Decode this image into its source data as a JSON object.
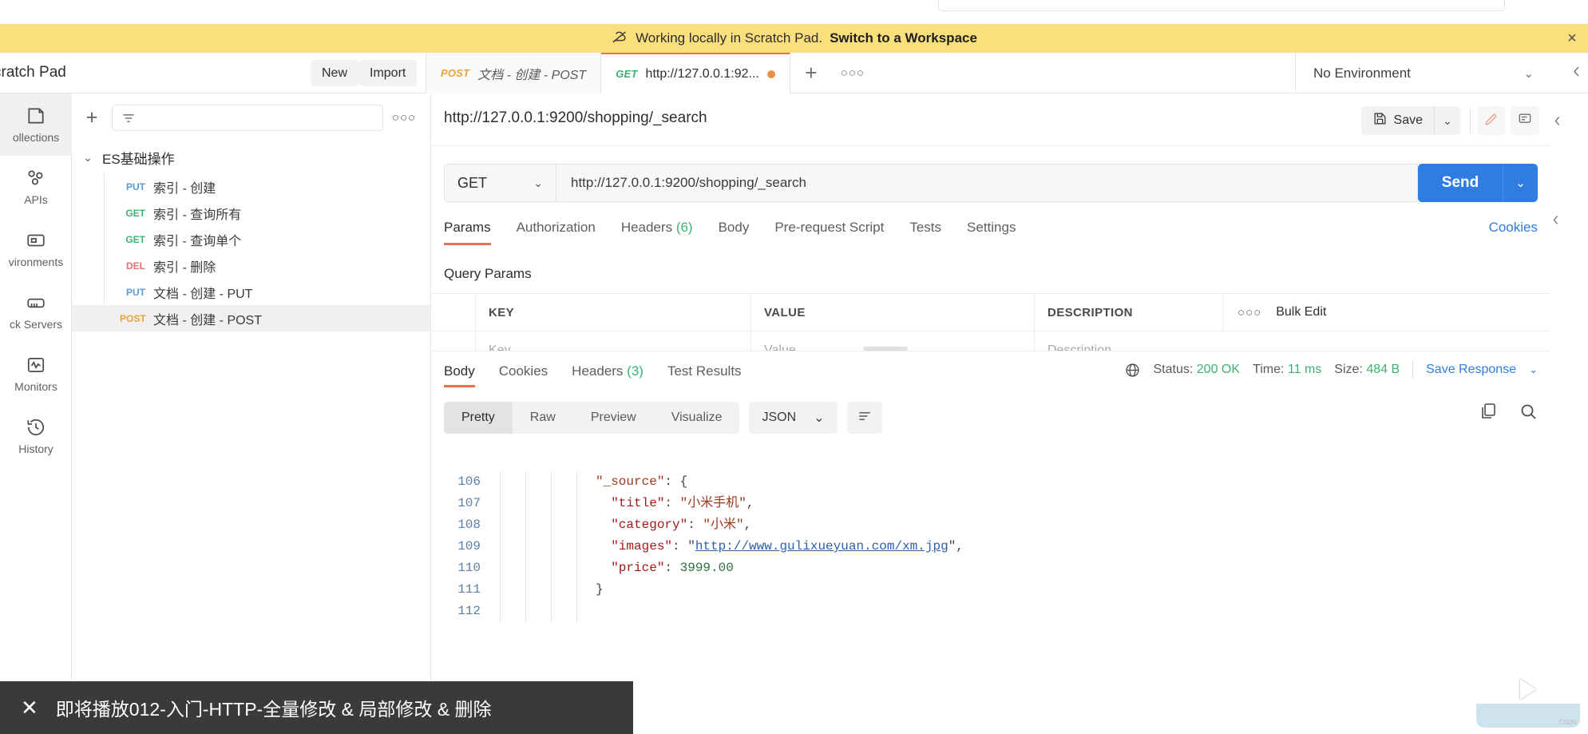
{
  "banner": {
    "icon": "cloud-off-icon",
    "text": "Working locally in Scratch Pad.",
    "link": "Switch to a Workspace",
    "close": "×"
  },
  "header": {
    "workspace_title": "cratch Pad",
    "new_label": "New",
    "import_label": "Import",
    "environment": {
      "selected": "No Environment",
      "caret": "⌄"
    },
    "tabs": [
      {
        "method": "POST",
        "label": "文档 - 创建 - POST",
        "active": false,
        "unsaved": false
      },
      {
        "method": "GET",
        "label": "http://127.0.0.1:92...",
        "active": true,
        "unsaved": true
      }
    ],
    "new_tab_label": "+",
    "tab_options_label": "○○○"
  },
  "rail": {
    "items": [
      {
        "label": "ollections",
        "icon": "collections-icon",
        "active": true
      },
      {
        "label": "APIs",
        "icon": "apis-icon",
        "active": false
      },
      {
        "label": "vironments",
        "icon": "environments-icon",
        "active": false
      },
      {
        "label": "ck Servers",
        "icon": "mock-servers-icon",
        "active": false
      },
      {
        "label": "Monitors",
        "icon": "monitors-icon",
        "active": false
      },
      {
        "label": "History",
        "icon": "history-icon",
        "active": false
      }
    ]
  },
  "collections": {
    "add_label": "+",
    "filter_placeholder": "",
    "options_label": "○○○",
    "root": {
      "name": "ES基础操作",
      "caret": "⌄"
    },
    "requests": [
      {
        "method": "PUT",
        "name": "索引 - 创建",
        "active": false
      },
      {
        "method": "GET",
        "name": "索引 - 查询所有",
        "active": false
      },
      {
        "method": "GET",
        "name": "索引 - 查询单个",
        "active": false
      },
      {
        "method": "DEL",
        "name": "索引 - 删除",
        "active": false
      },
      {
        "method": "PUT",
        "name": "文档 - 创建 - PUT",
        "active": false
      },
      {
        "method": "POST",
        "name": "文档 - 创建 - POST",
        "active": true
      }
    ]
  },
  "request": {
    "title": "http://127.0.0.1:9200/shopping/_search",
    "save_label": "Save",
    "save_caret": "⌄",
    "method": "GET",
    "method_caret": "⌄",
    "url": "http://127.0.0.1:9200/shopping/_search",
    "send_label": "Send",
    "send_caret": "⌄",
    "tabs": [
      {
        "label": "Params",
        "badge": "",
        "active": true
      },
      {
        "label": "Authorization",
        "badge": "",
        "active": false
      },
      {
        "label": "Headers",
        "badge": "(6)",
        "active": false
      },
      {
        "label": "Body",
        "badge": "",
        "active": false
      },
      {
        "label": "Pre-request Script",
        "badge": "",
        "active": false
      },
      {
        "label": "Tests",
        "badge": "",
        "active": false
      },
      {
        "label": "Settings",
        "badge": "",
        "active": false
      }
    ],
    "cookies_link": "Cookies",
    "query_params_title": "Query Params",
    "params_table": {
      "headers": [
        "KEY",
        "VALUE",
        "DESCRIPTION"
      ],
      "placeholders": [
        "Key",
        "Value",
        "Description"
      ],
      "options_label": "○○○",
      "bulk_edit_label": "Bulk Edit"
    }
  },
  "response": {
    "tabs": [
      {
        "label": "Body",
        "badge": "",
        "active": true
      },
      {
        "label": "Cookies",
        "badge": "",
        "active": false
      },
      {
        "label": "Headers",
        "badge": "(3)",
        "active": false
      },
      {
        "label": "Test Results",
        "badge": "",
        "active": false
      }
    ],
    "status_label": "Status:",
    "status_value": "200 OK",
    "time_label": "Time:",
    "time_value": "11 ms",
    "size_label": "Size:",
    "size_value": "484 B",
    "save_response": "Save Response",
    "save_response_caret": "⌄",
    "format_tabs": [
      {
        "label": "Pretty",
        "active": true
      },
      {
        "label": "Raw",
        "active": false
      },
      {
        "label": "Preview",
        "active": false
      },
      {
        "label": "Visualize",
        "active": false
      }
    ],
    "language": "JSON",
    "language_caret": "⌄",
    "code": {
      "line_numbers": [
        "106",
        "107",
        "108",
        "109",
        "110",
        "111",
        "112"
      ],
      "lines": [
        {
          "indent": 0,
          "segments": [
            {
              "t": "str",
              "v": "\"_source\""
            },
            {
              "t": "pun",
              "v": ": {"
            }
          ]
        },
        {
          "indent": 1,
          "segments": [
            {
              "t": "key",
              "v": "\"title\""
            },
            {
              "t": "pun",
              "v": ": "
            },
            {
              "t": "str",
              "v": "\"小米手机\""
            },
            {
              "t": "pun",
              "v": ","
            }
          ]
        },
        {
          "indent": 1,
          "segments": [
            {
              "t": "key",
              "v": "\"category\""
            },
            {
              "t": "pun",
              "v": ": "
            },
            {
              "t": "str",
              "v": "\"小米\""
            },
            {
              "t": "pun",
              "v": ","
            }
          ]
        },
        {
          "indent": 1,
          "segments": [
            {
              "t": "key",
              "v": "\"images\""
            },
            {
              "t": "pun",
              "v": ": "
            },
            {
              "t": "pun",
              "v": "\""
            },
            {
              "t": "link",
              "v": "http://www.gulixueyuan.com/xm.jpg"
            },
            {
              "t": "pun",
              "v": "\","
            }
          ]
        },
        {
          "indent": 1,
          "segments": [
            {
              "t": "key",
              "v": "\"price\""
            },
            {
              "t": "pun",
              "v": ": "
            },
            {
              "t": "num",
              "v": "3999.00"
            }
          ]
        },
        {
          "indent": 0,
          "segments": [
            {
              "t": "pun",
              "v": "}"
            }
          ]
        },
        {
          "indent": 0,
          "segments": [
            {
              "t": "pun",
              "v": ""
            }
          ]
        }
      ]
    }
  },
  "notification": {
    "close": "✕",
    "text": "即将播放012-入门-HTTP-全量修改 & 局部修改 & 删除"
  },
  "colors": {
    "banner_bg": "#fbdf7c",
    "accent_orange": "#e8734a",
    "send_blue": "#2f7de1",
    "link_blue": "#2f7de1",
    "status_green": "#3bb273",
    "method_get": "#3bb273",
    "method_post": "#e9a33a",
    "method_put": "#5b9bd5",
    "method_del": "#e87272"
  }
}
